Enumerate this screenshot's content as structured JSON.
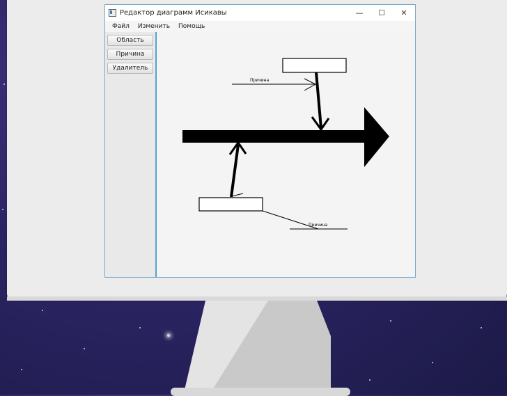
{
  "window": {
    "title": "Редактор диаграмм Исикавы",
    "controls": [
      "—",
      "☐",
      "✕"
    ]
  },
  "menu": [
    "Файл",
    "Изменить",
    "Помощь"
  ],
  "toolbar": {
    "area_label": "Область",
    "cause_label": "Причина",
    "delete_label": "Удалитель"
  },
  "diagram": {
    "cause_top_label": "Причина",
    "cause_bottom_label": "Причина"
  }
}
